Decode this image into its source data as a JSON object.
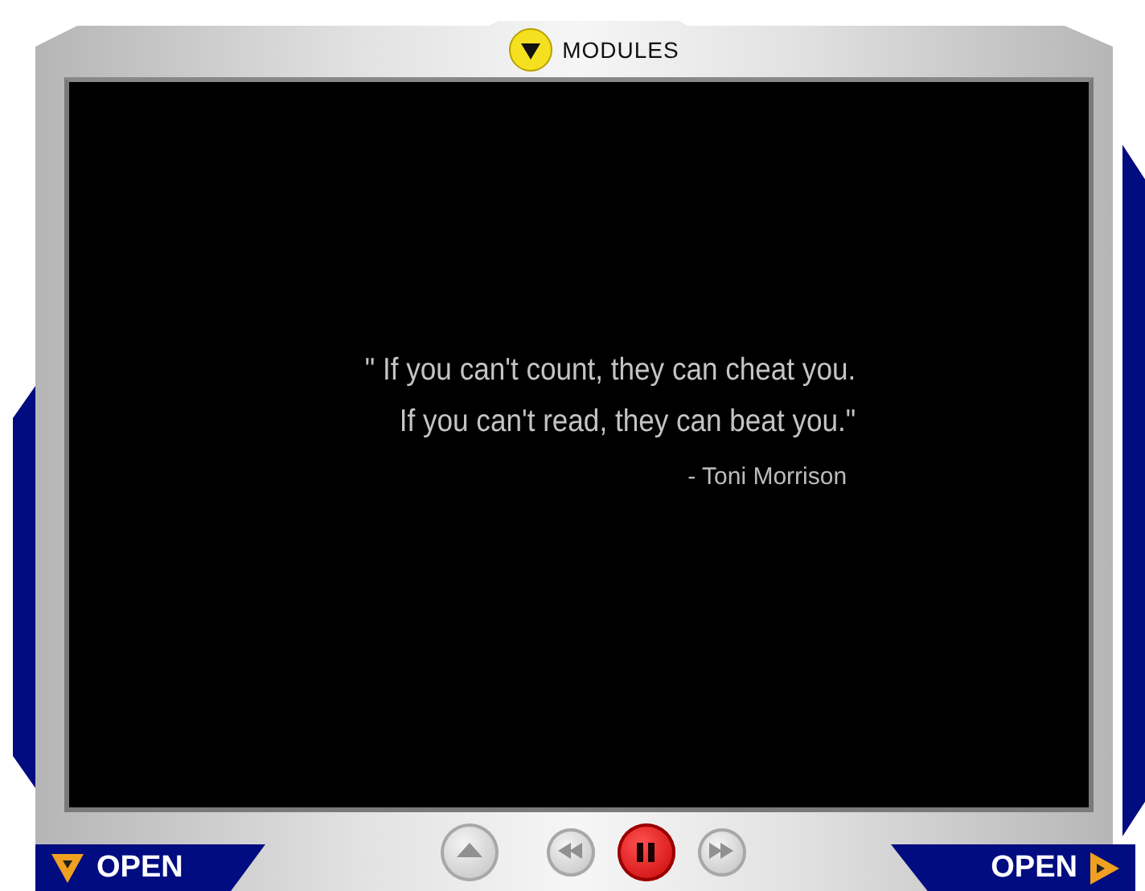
{
  "header": {
    "modules_label": "MODULES"
  },
  "quote": {
    "lines": [
      "\" If you can't count, they can cheat you.",
      "If you can't read, they can beat you.\""
    ],
    "attribution": "- Toni Morrison"
  },
  "controls": [
    {
      "kind": "eject",
      "active": false
    },
    {
      "kind": "rewind",
      "active": false
    },
    {
      "kind": "pause",
      "active": true
    },
    {
      "kind": "forward",
      "active": false
    }
  ],
  "open_left": {
    "label": "OPEN"
  },
  "open_right": {
    "label": "OPEN"
  }
}
